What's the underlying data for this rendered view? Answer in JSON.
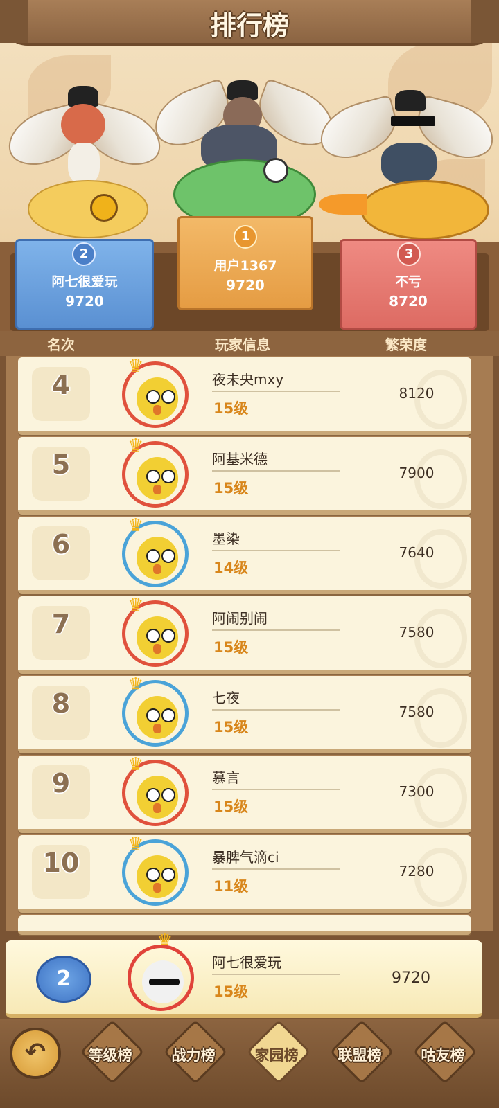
{
  "title": "排行榜",
  "podium": [
    {
      "rank": "2",
      "name": "阿七很爱玩",
      "score": "9720"
    },
    {
      "rank": "1",
      "name": "用户1367",
      "score": "9720"
    },
    {
      "rank": "3",
      "name": "不亏",
      "score": "8720"
    }
  ],
  "columns": {
    "rank": "名次",
    "player": "玩家信息",
    "score": "繁荣度"
  },
  "rows": [
    {
      "rank": "4",
      "name": "夜未央mxy",
      "level": "15级",
      "score": "8120"
    },
    {
      "rank": "5",
      "name": "阿基米德",
      "level": "15级",
      "score": "7900"
    },
    {
      "rank": "6",
      "name": "墨染",
      "level": "14级",
      "score": "7640"
    },
    {
      "rank": "7",
      "name": "阿闹别闹",
      "level": "15级",
      "score": "7580"
    },
    {
      "rank": "8",
      "name": "七夜",
      "level": "15级",
      "score": "7580"
    },
    {
      "rank": "9",
      "name": "慕言",
      "level": "15级",
      "score": "7300"
    },
    {
      "rank": "10",
      "name": "暴脾气滴ci",
      "level": "11级",
      "score": "7280"
    }
  ],
  "self": {
    "rank": "2",
    "name": "阿七很爱玩",
    "level": "15级",
    "score": "9720"
  },
  "tabs": [
    {
      "label": "等级榜",
      "active": false
    },
    {
      "label": "战力榜",
      "active": false
    },
    {
      "label": "家园榜",
      "active": true
    },
    {
      "label": "联盟榜",
      "active": false
    },
    {
      "label": "咕友榜",
      "active": false
    }
  ],
  "icons": {
    "back": "back-arrow-icon"
  }
}
